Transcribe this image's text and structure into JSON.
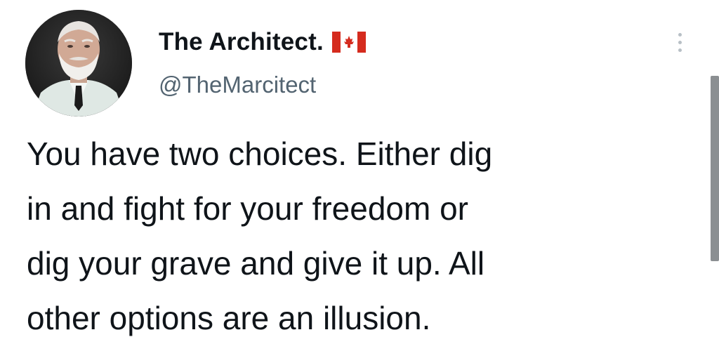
{
  "tweet": {
    "avatar_icon": "profile-avatar-elderly-man-with-white-beard",
    "display_name": "The Architect.",
    "flag_icon": "canada-flag-icon",
    "handle": "@TheMarcitect",
    "more_icon": "vertical-ellipsis-icon",
    "text": "You have two choices. Either dig\nin and fight for your freedom or\ndig your grave and give it up. All\nother options are an illusion."
  },
  "colors": {
    "background": "#ffffff",
    "primary_text": "#0f1419",
    "secondary_text": "#536471",
    "flag_red": "#d52b1e",
    "scrollbar": "#8b8f92"
  }
}
